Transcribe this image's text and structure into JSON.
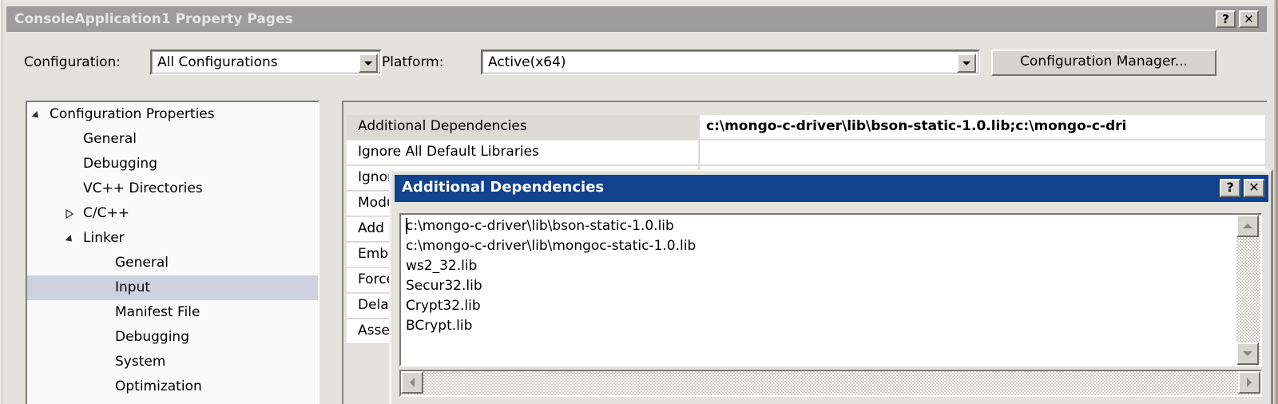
{
  "window": {
    "title": "ConsoleApplication1 Property Pages",
    "help_button": "?",
    "close_button": "✕"
  },
  "config_bar": {
    "configuration_label": "Configuration:",
    "configuration_value": "All Configurations",
    "platform_label": "Platform:",
    "platform_value": "Active(x64)",
    "config_manager_button": "Configuration Manager..."
  },
  "tree": {
    "items": [
      {
        "label": "Configuration Properties",
        "indent": 28,
        "marker": "expanded",
        "selected": false
      },
      {
        "label": "General",
        "indent": 70,
        "marker": "none",
        "selected": false
      },
      {
        "label": "Debugging",
        "indent": 70,
        "marker": "none",
        "selected": false
      },
      {
        "label": "VC++ Directories",
        "indent": 70,
        "marker": "none",
        "selected": false
      },
      {
        "label": "C/C++",
        "indent": 70,
        "marker": "collapsed",
        "selected": false
      },
      {
        "label": "Linker",
        "indent": 70,
        "marker": "expanded",
        "selected": false
      },
      {
        "label": "General",
        "indent": 110,
        "marker": "none",
        "selected": false
      },
      {
        "label": "Input",
        "indent": 110,
        "marker": "none",
        "selected": true
      },
      {
        "label": "Manifest File",
        "indent": 110,
        "marker": "none",
        "selected": false
      },
      {
        "label": "Debugging",
        "indent": 110,
        "marker": "none",
        "selected": false
      },
      {
        "label": "System",
        "indent": 110,
        "marker": "none",
        "selected": false
      },
      {
        "label": "Optimization",
        "indent": 110,
        "marker": "none",
        "selected": false
      }
    ]
  },
  "grid": {
    "rows": [
      {
        "name": "Additional Dependencies",
        "value": "c:\\mongo-c-driver\\lib\\bson-static-1.0.lib;c:\\mongo-c-dri",
        "selected": true,
        "bold": true
      },
      {
        "name": "Ignore All Default Libraries",
        "value": "",
        "selected": false,
        "bold": false
      },
      {
        "name": "Ignore Specific Default Libraries",
        "value": "",
        "selected": false,
        "bold": false
      },
      {
        "name": "Module Definition File",
        "value": "",
        "selected": false,
        "bold": false
      },
      {
        "name": "Add Module to Assembly",
        "value": "",
        "selected": false,
        "bold": false
      },
      {
        "name": "Embed Managed Resource File",
        "value": "",
        "selected": false,
        "bold": false
      },
      {
        "name": "Force Symbol References",
        "value": "",
        "selected": false,
        "bold": false
      },
      {
        "name": "Delay Loaded Dlls",
        "value": "",
        "selected": false,
        "bold": false
      },
      {
        "name": "Assembly Link Resource",
        "value": "",
        "selected": false,
        "bold": false
      }
    ]
  },
  "modal": {
    "title": "Additional Dependencies",
    "help_button": "?",
    "close_button": "✕",
    "text_lines": [
      "c:\\mongo-c-driver\\lib\\bson-static-1.0.lib",
      "c:\\mongo-c-driver\\lib\\mongoc-static-1.0.lib",
      "ws2_32.lib",
      "Secur32.lib",
      "Crypt32.lib",
      "BCrypt.lib"
    ]
  },
  "colors": {
    "modal_titlebar": "#12428e",
    "window_titlebar_inactive": "#9c9c9c",
    "tree_selection": "#cdd1e0",
    "grid_selection": "#dcdad5",
    "dialog_face": "#e4e2dd"
  }
}
